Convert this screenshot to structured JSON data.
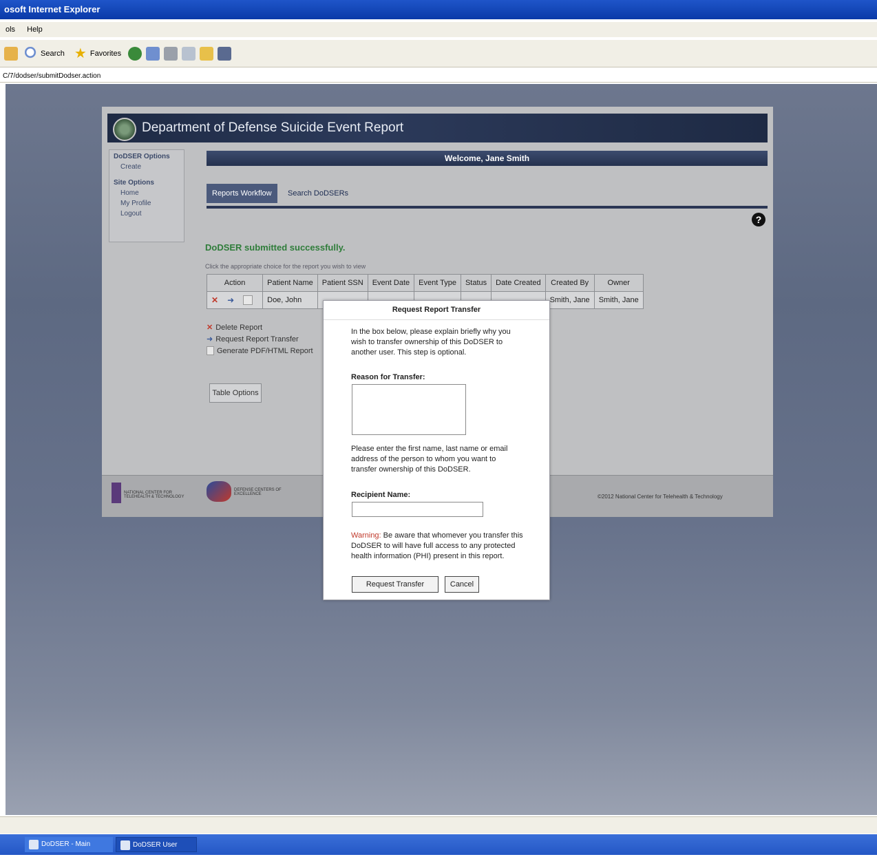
{
  "browser": {
    "title": "osoft Internet Explorer",
    "menu": [
      "ols",
      "Help"
    ],
    "toolbar": {
      "search": "Search",
      "favorites": "Favorites"
    },
    "address": "C/7/dodser/submitDodser.action"
  },
  "app": {
    "title": "Department of Defense Suicide Event Report",
    "welcome": "Welcome, Jane Smith",
    "sidebar": {
      "sections": [
        {
          "title": "DoDSER Options",
          "items": [
            "Create"
          ]
        },
        {
          "title": "Site Options",
          "items": [
            "Home",
            "My Profile",
            "Logout"
          ]
        }
      ]
    },
    "tabs": [
      "Reports Workflow",
      "Search DoDSERs"
    ],
    "success_message": "DoDSER submitted successfully.",
    "hint": "Click the appropriate choice for the report you wish to view",
    "table": {
      "headers": [
        "Action",
        "Patient Name",
        "Patient SSN",
        "Event Date",
        "Event Type",
        "Status",
        "Date Created",
        "Created By",
        "Owner"
      ],
      "rows": [
        [
          "",
          "Doe, John",
          "",
          "",
          "",
          "",
          "",
          "Smith, Jane",
          "Smith, Jane"
        ]
      ]
    },
    "row_actions": [
      "Delete Report",
      "Request Report Transfer",
      "Generate PDF/HTML Report"
    ],
    "table_options": "Table Options",
    "footer": {
      "logo1": "NATIONAL CENTER FOR TELEHEALTH & TECHNOLOGY",
      "logo2": "DEFENSE CENTERS OF EXCELLENCE",
      "copyright": "©2012 National Center for Telehealth & Technology"
    }
  },
  "modal": {
    "title": "Request Report Transfer",
    "intro": "In the box below, please explain briefly why you wish to transfer ownership of this DoDSER to another user. This step is optional.",
    "reason_label": "Reason for Transfer:",
    "recipient_intro": "Please enter the first name, last name or email address of the person to whom you want to transfer ownership of this DoDSER.",
    "recipient_label": "Recipient Name:",
    "warning_prefix": "Warning:",
    "warning_text": " Be aware that whomever you transfer this DoDSER to will have full access to any protected health information (PHI) present in this report.",
    "request_button": "Request Transfer",
    "cancel_button": "Cancel"
  },
  "taskbar": {
    "items": [
      "DoDSER - Main Menu...",
      "DoDSER User Manual..."
    ]
  },
  "colors": {
    "header_navy": "#1e2a44",
    "success_green": "#2f7d3a",
    "warning_red": "#c0392b",
    "taskbar_blue": "#2457c5"
  }
}
